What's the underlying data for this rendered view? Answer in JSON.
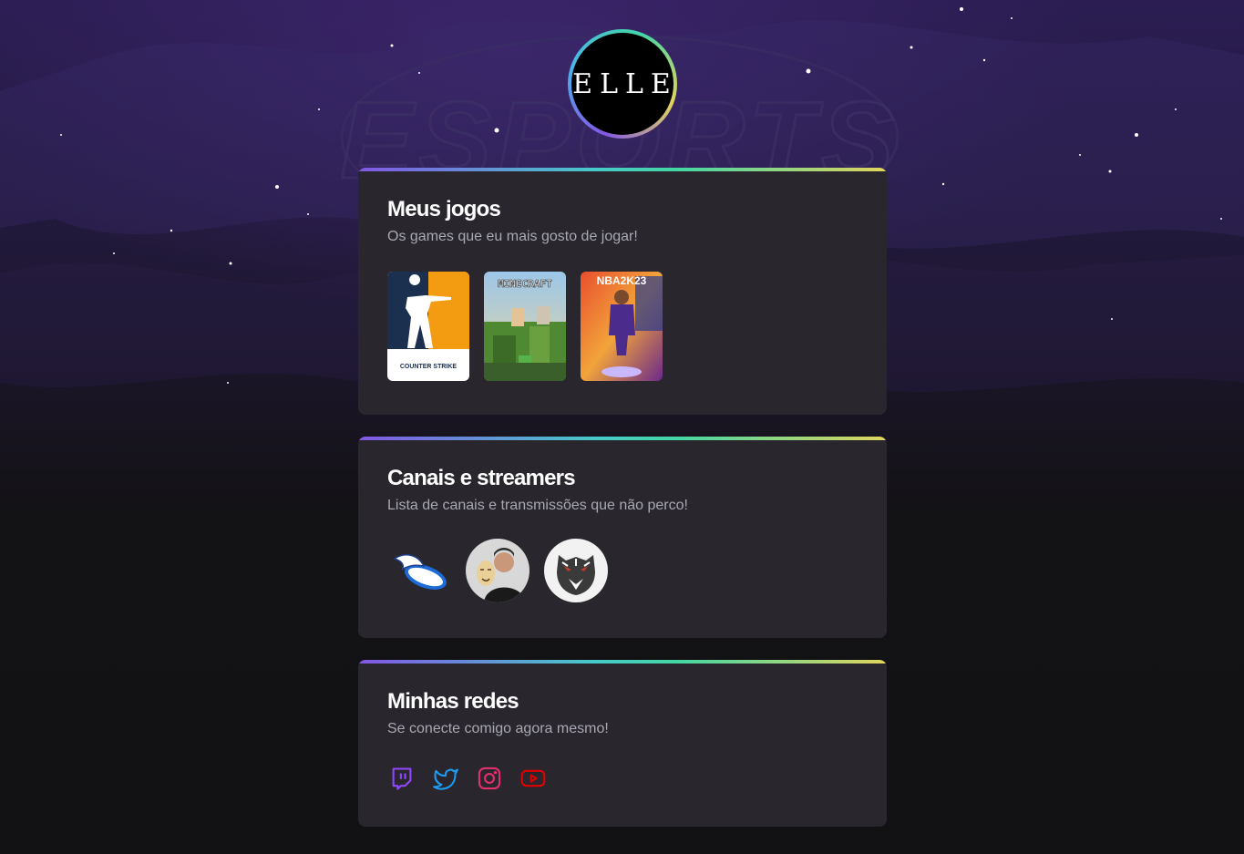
{
  "profile": {
    "avatar_text": "ELLE"
  },
  "games_section": {
    "title": "Meus jogos",
    "subtitle": "Os games que eu mais gosto de jogar!",
    "games": [
      {
        "name": "counter-strike",
        "cover_text": "COUNTER STRIKE",
        "accent": "#f39c12"
      },
      {
        "name": "minecraft",
        "cover_text": "MINECRAFT",
        "accent": "#5a9e3a"
      },
      {
        "name": "nba-2k23",
        "cover_text": "NBA2K23",
        "accent": "#e8503a"
      }
    ]
  },
  "channels_section": {
    "title": "Canais e streamers",
    "subtitle": "Lista de canais e transmissões que não perco!",
    "channels": [
      {
        "name": "channel-winged-logo"
      },
      {
        "name": "channel-streamer-with-mask"
      },
      {
        "name": "channel-tiger-logo"
      }
    ]
  },
  "social_section": {
    "title": "Minhas redes",
    "subtitle": "Se conecte comigo agora mesmo!",
    "links": [
      {
        "icon": "twitch-icon",
        "color": "#9146ff"
      },
      {
        "icon": "twitter-icon",
        "color": "#1d9bf0"
      },
      {
        "icon": "instagram-icon",
        "color": "#e1306c"
      },
      {
        "icon": "youtube-icon",
        "color": "#ff0000"
      }
    ]
  }
}
